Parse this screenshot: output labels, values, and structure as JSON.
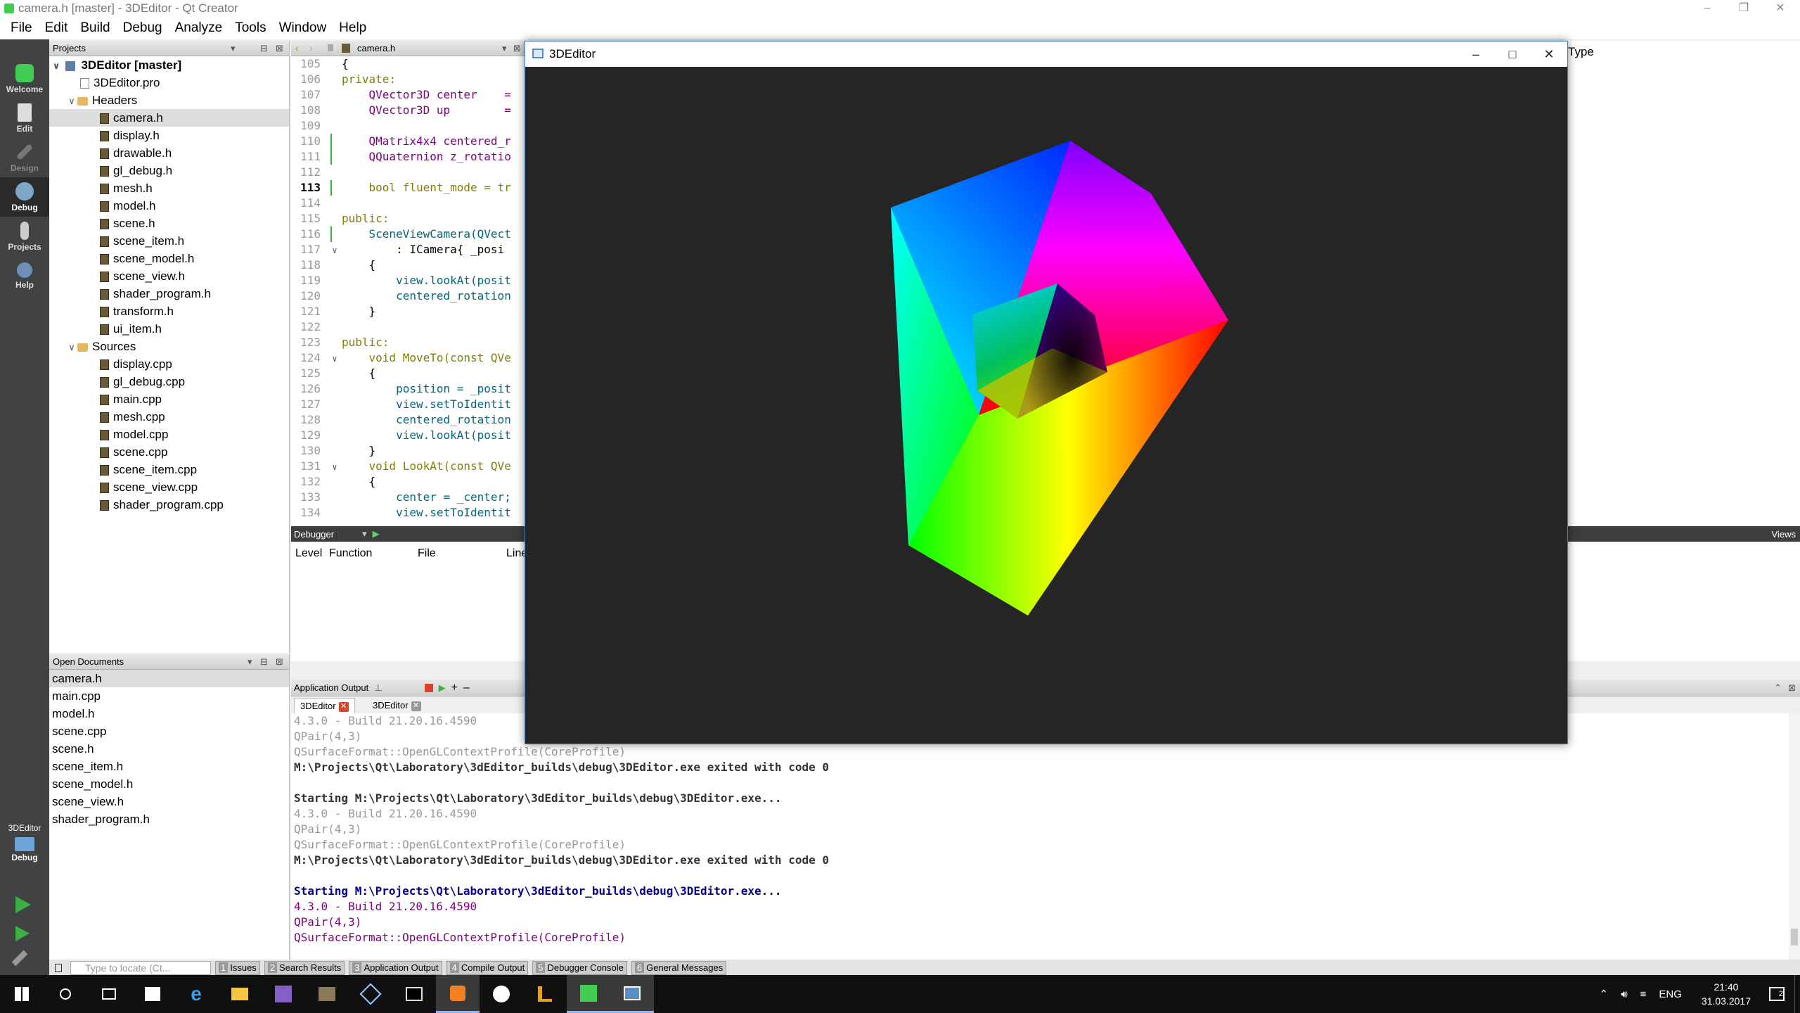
{
  "window": {
    "title": "camera.h [master] - 3DEditor - Qt Creator"
  },
  "menu": [
    "File",
    "Edit",
    "Build",
    "Debug",
    "Analyze",
    "Tools",
    "Window",
    "Help"
  ],
  "modes": [
    {
      "label": "Welcome",
      "icon": "qt-logo-icon"
    },
    {
      "label": "Edit",
      "icon": "document-icon"
    },
    {
      "label": "Design",
      "icon": "pencil-icon"
    },
    {
      "label": "Debug",
      "icon": "bug-icon"
    },
    {
      "label": "Projects",
      "icon": "wrench-icon"
    },
    {
      "label": "Help",
      "icon": "question-icon"
    }
  ],
  "kit": {
    "project": "3DEditor",
    "mode": "Debug"
  },
  "projects_panel": {
    "header": "Projects",
    "root": "3DEditor [master]",
    "pro_file": "3DEditor.pro",
    "headers_label": "Headers",
    "headers": [
      "camera.h",
      "display.h",
      "drawable.h",
      "gl_debug.h",
      "mesh.h",
      "model.h",
      "scene.h",
      "scene_item.h",
      "scene_model.h",
      "scene_view.h",
      "shader_program.h",
      "transform.h",
      "ui_item.h"
    ],
    "sources_label": "Sources",
    "sources": [
      "display.cpp",
      "gl_debug.cpp",
      "main.cpp",
      "mesh.cpp",
      "model.cpp",
      "scene.cpp",
      "scene_item.cpp",
      "scene_view.cpp",
      "shader_program.cpp"
    ],
    "selected": "camera.h"
  },
  "open_documents": {
    "header": "Open Documents",
    "items": [
      "camera.h",
      "main.cpp",
      "model.h",
      "scene.cpp",
      "scene.h",
      "scene_item.h",
      "scene_model.h",
      "scene_view.h",
      "shader_program.h"
    ]
  },
  "editor": {
    "file_tab": "camera.h",
    "type_label": "Type",
    "current_line": 113,
    "lines": [
      {
        "n": 105,
        "code": "{"
      },
      {
        "n": 106,
        "code": "private:"
      },
      {
        "n": 107,
        "code": "    QVector3D center    ="
      },
      {
        "n": 108,
        "code": "    QVector3D up        ="
      },
      {
        "n": 109,
        "code": ""
      },
      {
        "n": 110,
        "code": "    QMatrix4x4 centered_r"
      },
      {
        "n": 111,
        "code": "    QQuaternion z_rotatio"
      },
      {
        "n": 112,
        "code": ""
      },
      {
        "n": 113,
        "code": "    bool fluent_mode = tr"
      },
      {
        "n": 114,
        "code": ""
      },
      {
        "n": 115,
        "code": "public:"
      },
      {
        "n": 116,
        "code": "    SceneViewCamera(QVect"
      },
      {
        "n": 117,
        "code": "        : ICamera{ _posi"
      },
      {
        "n": 118,
        "code": "    {"
      },
      {
        "n": 119,
        "code": "        view.lookAt(posit"
      },
      {
        "n": 120,
        "code": "        centered_rotation"
      },
      {
        "n": 121,
        "code": "    }"
      },
      {
        "n": 122,
        "code": ""
      },
      {
        "n": 123,
        "code": "public:"
      },
      {
        "n": 124,
        "code": "    void MoveTo(const QVe"
      },
      {
        "n": 125,
        "code": "    {"
      },
      {
        "n": 126,
        "code": "        position = _posit"
      },
      {
        "n": 127,
        "code": "        view.setToIdentit"
      },
      {
        "n": 128,
        "code": "        centered_rotation"
      },
      {
        "n": 129,
        "code": "        view.lookAt(posit"
      },
      {
        "n": 130,
        "code": "    }"
      },
      {
        "n": 131,
        "code": "    void LookAt(const QVe"
      },
      {
        "n": 132,
        "code": "    {"
      },
      {
        "n": 133,
        "code": "        center = _center;"
      },
      {
        "n": 134,
        "code": "        view.setToIdentit"
      }
    ]
  },
  "debugger": {
    "header": "Debugger",
    "views_label": "Views",
    "columns": [
      "Level",
      "Function",
      "File",
      "Line"
    ]
  },
  "app_output": {
    "header": "Application Output",
    "tabs": [
      {
        "label": "3DEditor",
        "active": true
      },
      {
        "label": "3DEditor",
        "active": false
      }
    ],
    "lines": [
      {
        "text": "4.3.0 - Build 21.20.16.4590",
        "style": "gray"
      },
      {
        "text": "QPair(4,3)",
        "style": "gray"
      },
      {
        "text": "QSurfaceFormat::OpenGLContextProfile(CoreProfile)",
        "style": "gray"
      },
      {
        "text": "M:\\Projects\\Qt\\Laboratory\\3dEditor_builds\\debug\\3DEditor.exe exited with code 0",
        "style": "dark"
      },
      {
        "text": "",
        "style": "gray"
      },
      {
        "text": "Starting M:\\Projects\\Qt\\Laboratory\\3dEditor_builds\\debug\\3DEditor.exe...",
        "style": "dark"
      },
      {
        "text": "4.3.0 - Build 21.20.16.4590",
        "style": "gray"
      },
      {
        "text": "QPair(4,3)",
        "style": "gray"
      },
      {
        "text": "QSurfaceFormat::OpenGLContextProfile(CoreProfile)",
        "style": "gray"
      },
      {
        "text": "M:\\Projects\\Qt\\Laboratory\\3dEditor_builds\\debug\\3DEditor.exe exited with code 0",
        "style": "dark"
      },
      {
        "text": "",
        "style": "gray"
      },
      {
        "text": "Starting M:\\Projects\\Qt\\Laboratory\\3dEditor_builds\\debug\\3DEditor.exe...",
        "style": "blue"
      },
      {
        "text": "4.3.0 - Build 21.20.16.4590",
        "style": "purple"
      },
      {
        "text": "QPair(4,3)",
        "style": "purple"
      },
      {
        "text": "QSurfaceFormat::OpenGLContextProfile(CoreProfile)",
        "style": "purple"
      }
    ]
  },
  "statusbar": {
    "locator_placeholder": "Type to locate (Ct...",
    "panes": [
      {
        "num": "1",
        "label": "Issues"
      },
      {
        "num": "2",
        "label": "Search Results"
      },
      {
        "num": "3",
        "label": "Application Output"
      },
      {
        "num": "4",
        "label": "Compile Output"
      },
      {
        "num": "5",
        "label": "Debugger Console"
      },
      {
        "num": "6",
        "label": "General Messages"
      }
    ]
  },
  "app_window": {
    "title": "3DEditor"
  },
  "taskbar": {
    "time": "21:40",
    "date": "31.03.2017",
    "lang": "ENG",
    "notifications": "2"
  }
}
